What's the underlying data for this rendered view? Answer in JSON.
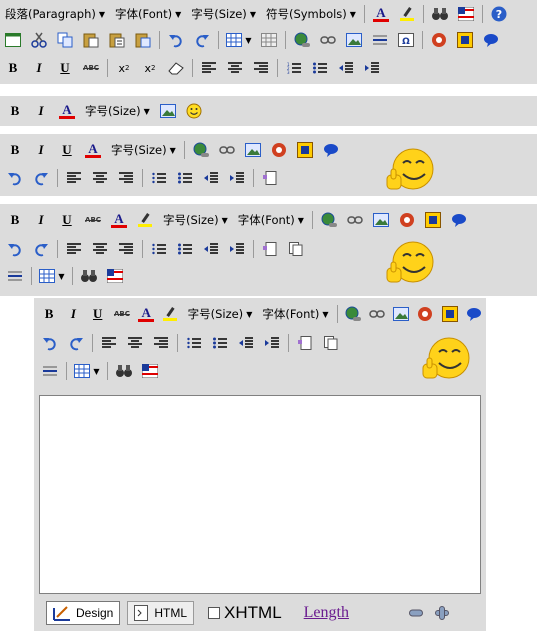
{
  "toolbar1": {
    "paragraph": "段落(Paragraph)",
    "font": "字体(Font)",
    "size": "字号(Size)",
    "symbols": "符号(Symbols)",
    "font_color_glyph": "A"
  },
  "toolbar2": {
    "size": "字号(Size)",
    "font_color_glyph": "A",
    "bold": "B",
    "italic": "I"
  },
  "toolbar3": {
    "size": "字号(Size)",
    "font_color_glyph": "A",
    "bold": "B",
    "italic": "I",
    "underline": "U"
  },
  "toolbar4": {
    "size": "字号(Size)",
    "font": "字体(Font)",
    "font_color_glyph": "A",
    "bold": "B",
    "italic": "I",
    "underline": "U",
    "strike": "ABC"
  },
  "editor": {
    "size": "字号(Size)",
    "font": "字体(Font)",
    "font_color_glyph": "A",
    "bold": "B",
    "italic": "I",
    "underline": "U",
    "strike": "ABC",
    "tab_design": "Design",
    "tab_html": "HTML",
    "xhtml_label": "XHTML",
    "length_label": "Length"
  },
  "common": {
    "bold": "B",
    "italic": "I",
    "underline": "U",
    "strike": "ABC",
    "superscript": "x",
    "subscript": "x",
    "sup_mark": "2",
    "sub_mark": "2"
  },
  "colors": {
    "toolbar_bg": "#dcdcdc",
    "font_color_underline": "#e00000",
    "highlight_color": "#ffee00",
    "link_color": "#6a1b8f"
  }
}
